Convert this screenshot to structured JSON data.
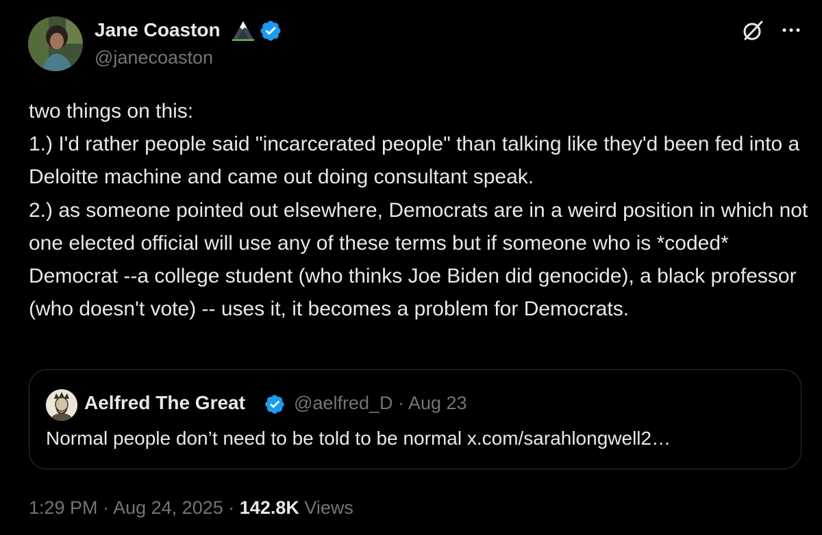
{
  "author": {
    "name": "Jane Coaston",
    "handle": "@janecoaston"
  },
  "icons": {
    "badge": "mountain-icon",
    "verified": "verified-icon",
    "grok": "grok-icon",
    "more": "more-icon"
  },
  "tweet": {
    "text": "two things on this:\n1.) I'd rather people said \"incarcerated people\" than talking like they'd been fed into a Deloitte machine and came out doing consultant speak.\n2.) as someone pointed out elsewhere, Democrats are in a weird position in which not one elected official will use any of these terms but if someone who is *coded* Democrat --a college student (who thinks Joe Biden did genocide), a black professor (who doesn't vote) -- uses it, it becomes a problem for Democrats."
  },
  "quote": {
    "name": "Aelfred The Great",
    "handle": "@aelfred_D",
    "separator": "·",
    "date": "Aug 23",
    "text": "Normal people don’t need to be told to be normal x.com/sarahlongwell2…"
  },
  "footer": {
    "time": "1:29 PM",
    "separator": "·",
    "date": "Aug 24, 2025",
    "views_count": "142.8K",
    "views_label": "Views"
  },
  "colors": {
    "background": "#000000",
    "text": "#e7e9ea",
    "secondary": "#71767b",
    "verified": "#1d9bf0",
    "border": "#2f3336"
  }
}
